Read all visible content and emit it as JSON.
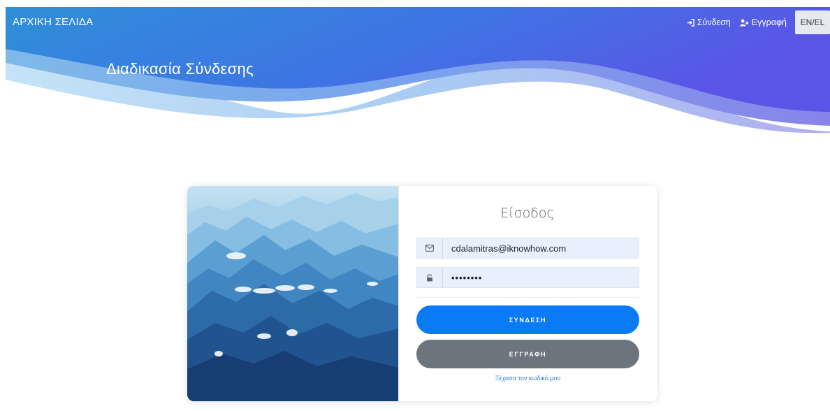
{
  "navbar": {
    "brand": "ΑΡΧΙΚΗ ΣΕΛΙΔΑ",
    "login_label": "Σύνδεση",
    "register_label": "Εγγραφή",
    "language_label": "EN/EL",
    "login_icon": "sign-in-icon",
    "register_icon": "user-plus-icon"
  },
  "header": {
    "title": "Διαδικασία Σύνδεσης"
  },
  "login_form": {
    "title": "Είσοδος",
    "email_value": "cdalamitras@iknowhow.com",
    "email_icon": "envelope-icon",
    "password_value": "••••••••",
    "password_icon": "unlock-icon",
    "login_button": "ΣΥΝΔΕΣΗ",
    "register_button": "ΕΓΓΡΑΦΗ",
    "forgot_link": "Ξέχασα τον κωδικό μου"
  },
  "colors": {
    "primary": "#0a7bf5",
    "secondary": "#6c757d",
    "header_gradient_start": "#2f8fd8",
    "header_gradient_end": "#5b54e6",
    "input_background": "#e8f0fe"
  }
}
